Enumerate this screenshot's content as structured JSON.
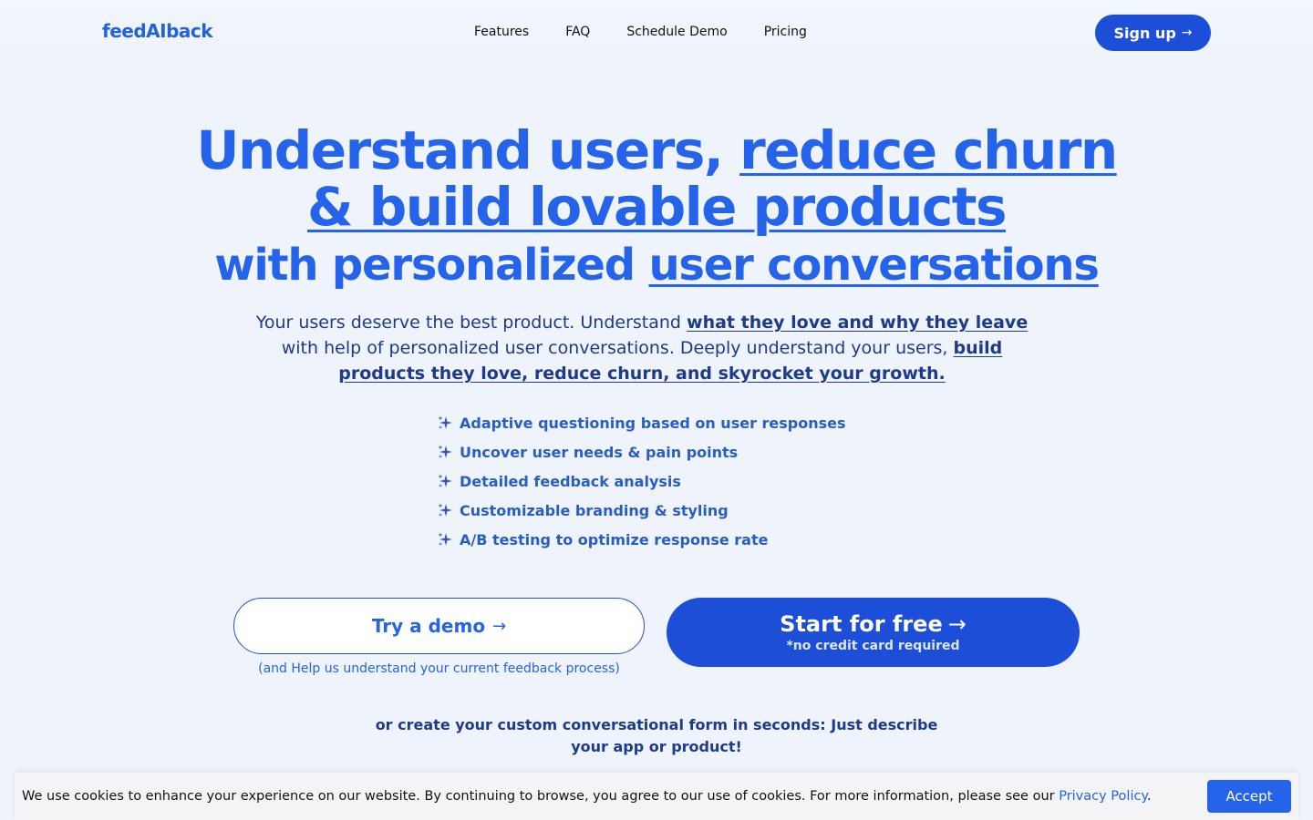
{
  "header": {
    "logo": "feedAIback",
    "nav": [
      "Features",
      "FAQ",
      "Schedule Demo",
      "Pricing"
    ],
    "signup_label": "Sign up",
    "signup_arrow": "→"
  },
  "hero": {
    "line1_plain": "Understand users, ",
    "line1_underlined": "reduce churn",
    "line2_underlined": "& build lovable products",
    "line3_plain": "with personalized ",
    "line3_underlined": "user conversations",
    "sub_part1": "Your users deserve the best product. Understand ",
    "sub_bold1": "what they love and why they leave ",
    "sub_part2": "with help of personalized user conversations. Deeply understand your users, ",
    "sub_bold2": "build products they love, reduce churn, and skyrocket your growth."
  },
  "features": [
    "Adaptive questioning based on user responses",
    "Uncover user needs & pain points",
    "Detailed feedback analysis",
    "Customizable branding & styling",
    "A/B testing to optimize response rate"
  ],
  "cta": {
    "demo_label": "Try a demo",
    "demo_arrow": "→",
    "demo_note": "(and Help us understand your current feedback process)",
    "start_label": "Start for free",
    "start_arrow": "→",
    "start_note": "*no credit card required",
    "create_text": "or create your custom conversational form in seconds: Just describe your app or product!"
  },
  "cookie": {
    "text": "We use cookies to enhance your experience on our website. By continuing to browse, you agree to our use of cookies. For more information, please see our ",
    "link": "Privacy Policy",
    "end": ".",
    "accept_label": "Accept"
  },
  "colors": {
    "accent": "#2563eb",
    "button": "#1d4ed8",
    "text_dark": "#1e3a8a",
    "background": "#eef3fc"
  },
  "icons": {
    "feature_bullet": "sparkles-icon",
    "arrow": "arrow-right-icon"
  }
}
